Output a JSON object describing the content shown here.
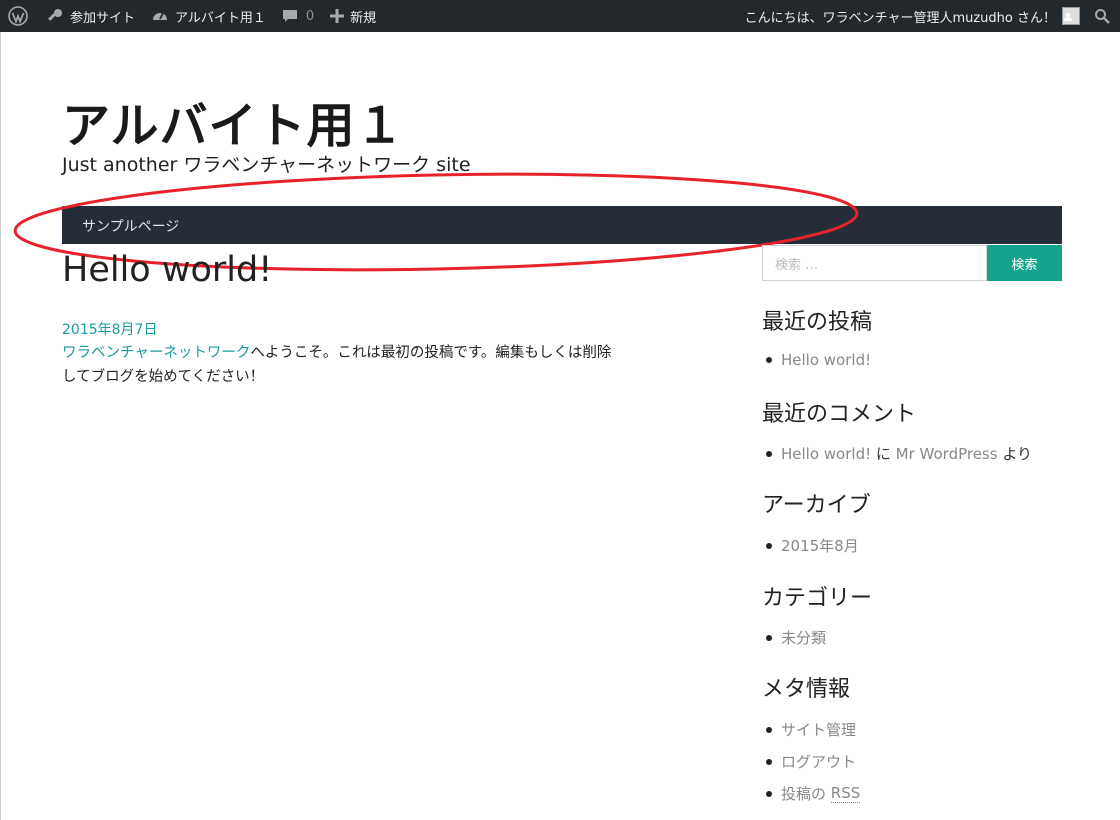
{
  "adminbar": {
    "wp_logo": "wordpress-icon",
    "my_sites": "参加サイト",
    "site_name": "アルバイト用１",
    "comments_count": "0",
    "new_label": "新規",
    "greeting": "こんにちは、ワラベンチャー管理人muzudho さん！"
  },
  "header": {
    "title": "アルバイト用１",
    "description": "Just another ワラベンチャーネットワーク site"
  },
  "nav": {
    "items": [
      {
        "label": "サンプルページ"
      }
    ]
  },
  "annotation": {
    "color": "#e8222b"
  },
  "post": {
    "title": "Hello world!",
    "date": "2015年8月7日",
    "body_link": "ワラベンチャーネットワーク",
    "body_line1": "へようこそ。これは最初の投稿です。編集もしくは削除",
    "body_line2": "してブログを始めてください！"
  },
  "sidebar": {
    "search": {
      "placeholder": "検索 …",
      "button": "検索"
    },
    "recent_posts": {
      "title": "最近の投稿",
      "items": [
        "Hello world!"
      ]
    },
    "recent_comments": {
      "title": "最近のコメント",
      "post": "Hello world!",
      "connector1": " に ",
      "author": "Mr WordPress",
      "connector2": " より"
    },
    "archives": {
      "title": "アーカイブ",
      "items": [
        "2015年8月"
      ]
    },
    "categories": {
      "title": "カテゴリー",
      "items": [
        "未分類"
      ]
    },
    "meta": {
      "title": "メタ情報",
      "site_admin": "サイト管理",
      "logout": "ログアウト",
      "entries_prefix": "投稿の ",
      "entries_rss": "RSS"
    }
  },
  "colors": {
    "adminbar": "#23282d",
    "nav": "#252e38",
    "accent": "#14a38b",
    "link": "#1a9b9b"
  }
}
